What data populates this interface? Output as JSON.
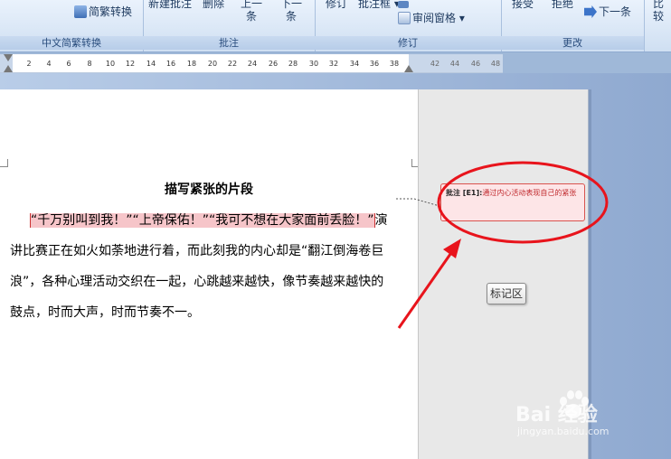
{
  "ribbon": {
    "groups": [
      {
        "label": "中文简繁转换",
        "buttons": [
          "简繁转换"
        ]
      },
      {
        "label": "批注",
        "buttons": [
          "新建批注",
          "删除",
          "上一条",
          "下一条"
        ]
      },
      {
        "label": "修订",
        "buttons": [
          "修订",
          "批注框",
          "审阅窗格"
        ]
      },
      {
        "label": "更改",
        "buttons": [
          "接受",
          "拒绝",
          "下一条"
        ]
      },
      {
        "label": "",
        "buttons": [
          "比较"
        ]
      }
    ],
    "prev_label_top": "上一",
    "prev_label_bottom": "条",
    "next_label_top": "下一",
    "next_label_bottom": "条"
  },
  "ruler": {
    "ticks": [
      "2",
      "4",
      "6",
      "8",
      "10",
      "12",
      "14",
      "16",
      "18",
      "20",
      "22",
      "24",
      "26",
      "28",
      "30",
      "32",
      "34",
      "36",
      "38",
      "42",
      "44",
      "46",
      "48"
    ]
  },
  "document": {
    "title": "描写紧张的片段",
    "highlighted": "“千万别叫到我！”“上帝保佑！”“我可不想在大家面前丢脸！”",
    "line1_tail": "演",
    "line2": "讲比赛正在如火如荼地进行着，而此刻我的内心却是“翻江倒海卷巨",
    "line3": "浪”，各种心理活动交织在一起，心跳越来越快，像节奏越来越快的",
    "line4": "鼓点，时而大声，时而节奏不一。"
  },
  "comment": {
    "label": "批注 [E1]:",
    "text": "通过内心活动表现自己的紧张"
  },
  "mark_button": "标记区",
  "watermark": {
    "brand": "Bai  经验",
    "url": "jingyan.baidu.com"
  },
  "colors": {
    "annotation_red": "#e8141c",
    "highlight": "#f6c5c9"
  }
}
